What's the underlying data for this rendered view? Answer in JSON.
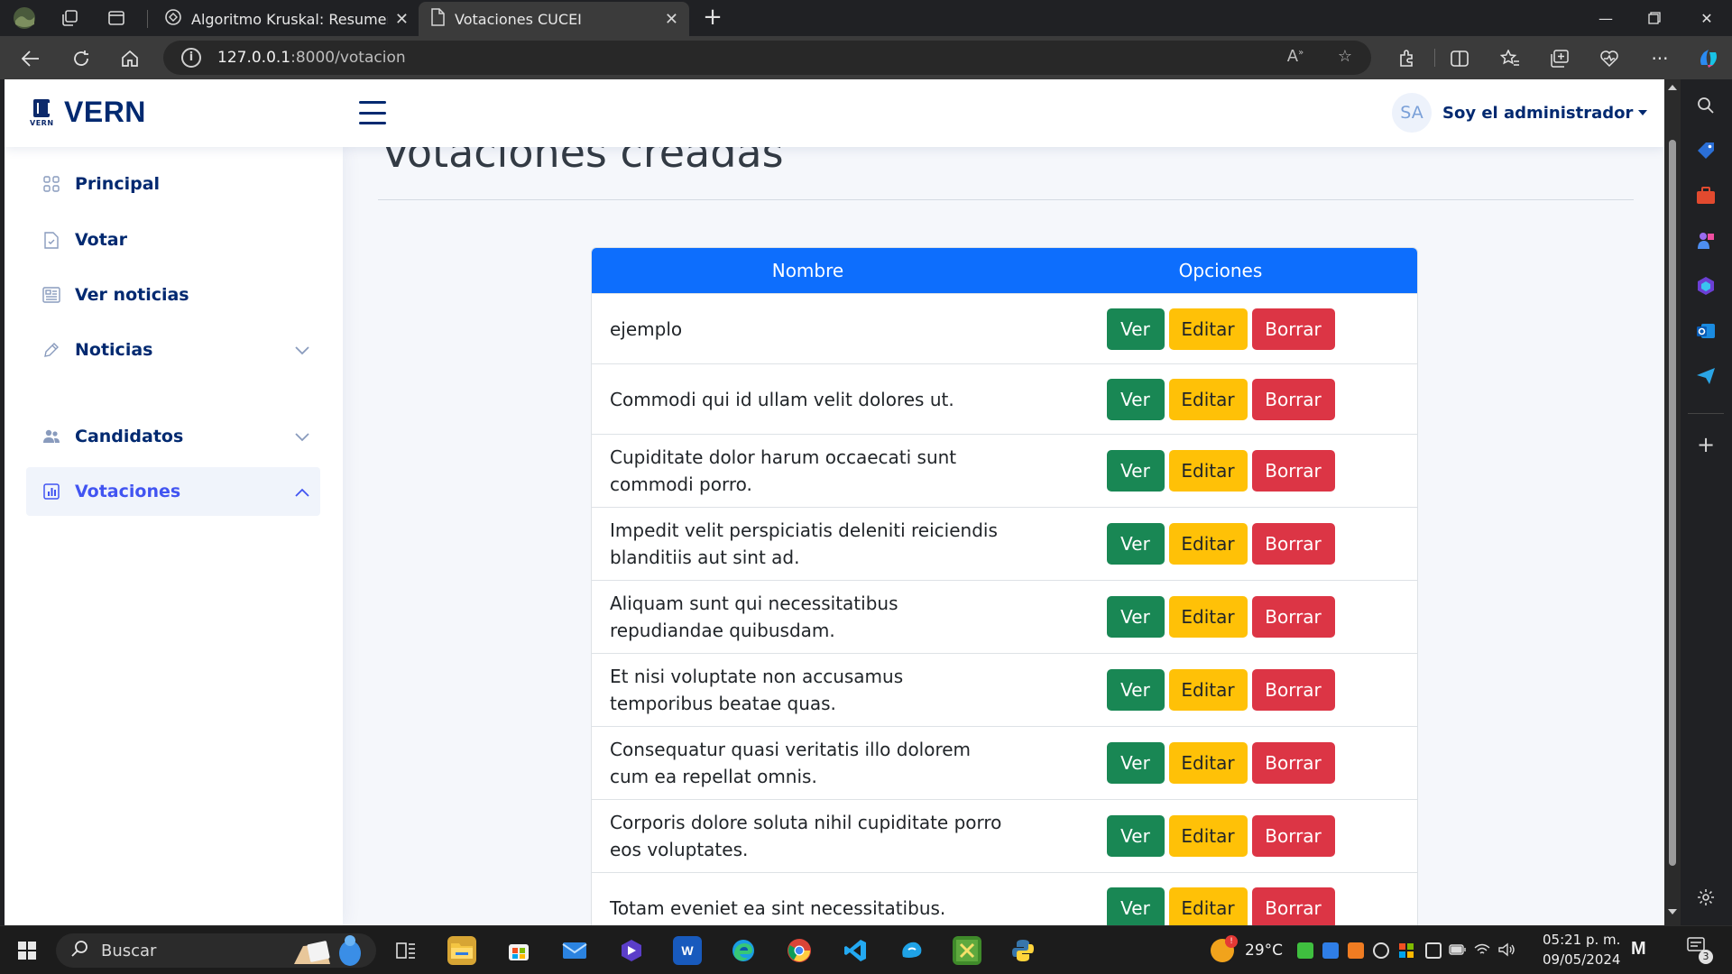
{
  "browser": {
    "tabs": [
      {
        "title": "Algoritmo Kruskal: Resumen Intr",
        "active": false
      },
      {
        "title": "Votaciones CUCEI",
        "active": true
      }
    ],
    "url_host": "127.0.0.1",
    "url_rest": ":8000/votacion"
  },
  "header": {
    "logo_text": "VERN",
    "logo_small": "VERN",
    "avatar_initials": "SA",
    "profile_name": "Soy el administrador"
  },
  "sidebar": {
    "items": [
      {
        "label": "Principal",
        "icon": "grid-icon"
      },
      {
        "label": "Votar",
        "icon": "document-check-icon"
      },
      {
        "label": "Ver noticias",
        "icon": "newspaper-icon"
      },
      {
        "label": "Noticias",
        "icon": "pen-icon"
      },
      {
        "label": "Candidatos",
        "icon": "people-icon"
      },
      {
        "label": "Votaciones",
        "icon": "bar-chart-icon"
      }
    ]
  },
  "main": {
    "title": "Votaciones creadas",
    "table": {
      "headers": [
        "Nombre",
        "Opciones"
      ],
      "buttons": {
        "view": "Ver",
        "edit": "Editar",
        "delete": "Borrar"
      },
      "rows": [
        "ejemplo",
        "Commodi qui id ullam velit dolores ut.",
        "Cupiditate dolor harum occaecati sunt commodi porro.",
        "Impedit velit perspiciatis deleniti reiciendis blanditiis aut sint ad.",
        "Aliquam sunt qui necessitatibus repudiandae quibusdam.",
        "Et nisi voluptate non accusamus temporibus beatae quas.",
        "Consequatur quasi veritatis illo dolorem cum ea repellat omnis.",
        "Corporis dolore soluta nihil cupiditate porro eos voluptates.",
        "Totam eveniet ea sint necessitatibus."
      ]
    }
  },
  "taskbar": {
    "search_placeholder": "Buscar",
    "weather": "29°C",
    "time": "05:21 p. m.",
    "date": "09/05/2024",
    "notification_count": "3"
  },
  "colors": {
    "primary": "#0d6efd",
    "success": "#198754",
    "warning": "#ffc107",
    "danger": "#dc3545",
    "brand": "#012970"
  }
}
